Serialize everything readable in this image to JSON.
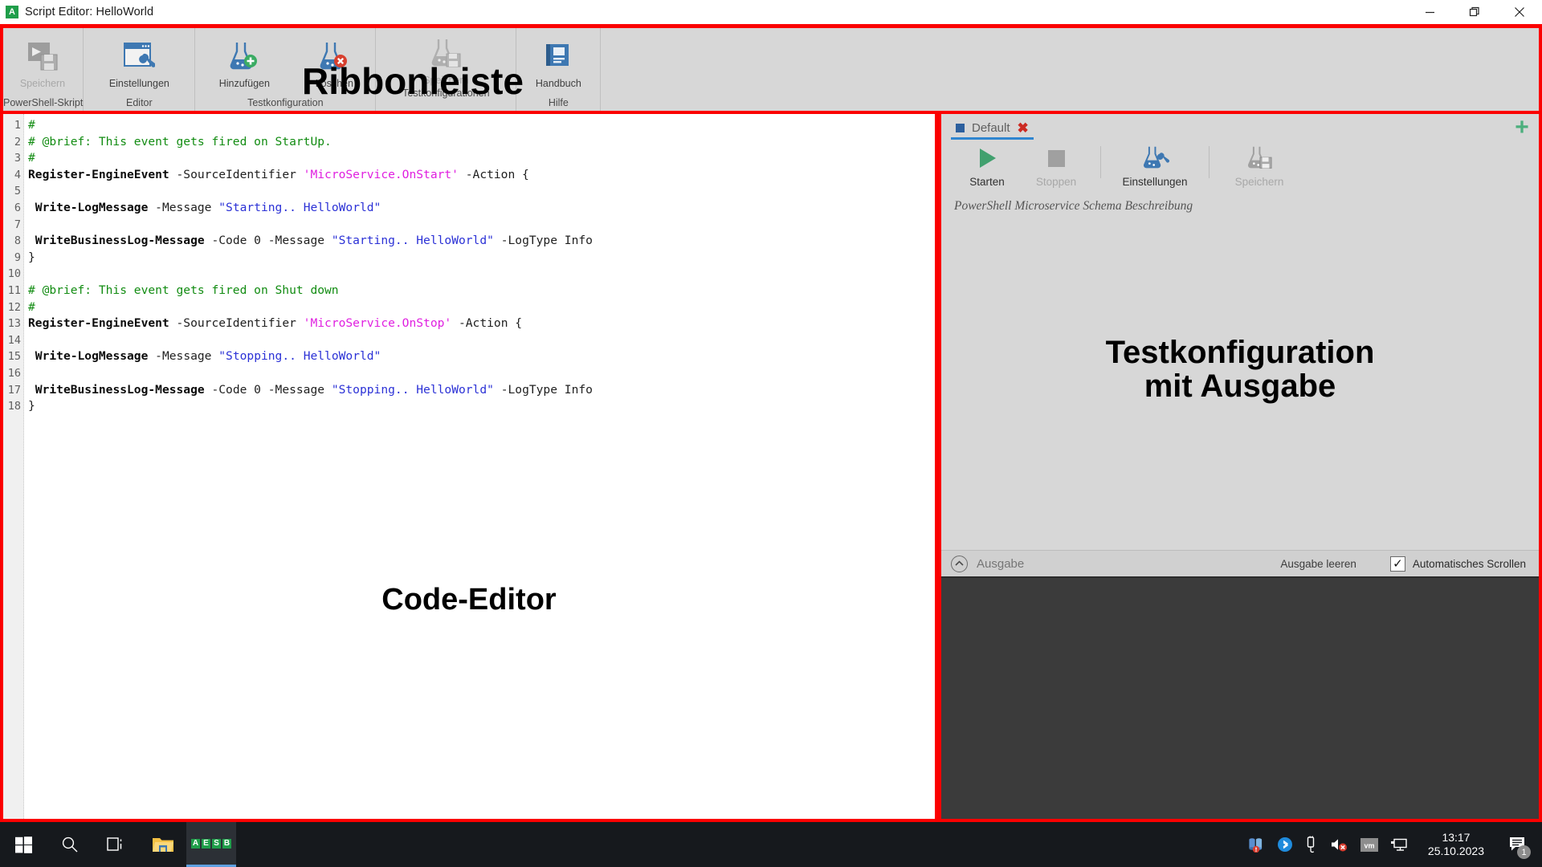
{
  "window": {
    "title": "Script Editor: HelloWorld",
    "app_icon": "A",
    "minimize": "minimize-icon",
    "maximize": "maximize-icon",
    "close": "close-icon"
  },
  "ribbon": {
    "annotation": "Ribbonleiste",
    "groups": [
      {
        "label": "PowerShell-Skript",
        "items": [
          {
            "caption": "Speichern",
            "icon": "save-script-icon",
            "disabled": true
          }
        ]
      },
      {
        "label": "Editor",
        "items": [
          {
            "caption": "Einstellungen",
            "icon": "editor-settings-icon",
            "disabled": false
          }
        ]
      },
      {
        "label": "Testkonfiguration",
        "items": [
          {
            "caption": "Hinzufügen",
            "icon": "flask-add-icon",
            "disabled": false
          },
          {
            "caption": "Löschen",
            "icon": "flask-delete-icon",
            "disabled": false
          }
        ]
      },
      {
        "label": "Testkonfigurationen",
        "items": [
          {
            "caption": "Speichern",
            "icon": "flask-save-icon",
            "disabled": true
          }
        ]
      },
      {
        "label": "Hilfe",
        "items": [
          {
            "caption": "Handbuch",
            "icon": "manual-book-icon",
            "disabled": false
          }
        ]
      }
    ]
  },
  "editor": {
    "annotation": "Code-Editor",
    "line_numbers": [
      "1",
      "2",
      "3",
      "4",
      "5",
      "6",
      "7",
      "8",
      "9",
      "10",
      "11",
      "12",
      "13",
      "14",
      "15",
      "16",
      "17",
      "18"
    ],
    "lines": [
      "#",
      "# @brief: This event gets fired on StartUp.",
      "#",
      "Register-EngineEvent -SourceIdentifier 'MicroService.OnStart' -Action {",
      "",
      " Write-LogMessage -Message \"Starting.. HelloWorld\"",
      "",
      " WriteBusinessLog-Message -Code 0 -Message \"Starting.. HelloWorld\" -LogType Info",
      "}",
      "",
      "# @brief: This event gets fired on Shut down",
      "#",
      "Register-EngineEvent -SourceIdentifier 'MicroService.OnStop' -Action {",
      "",
      " Write-LogMessage -Message \"Stopping.. HelloWorld\"",
      "",
      " WriteBusinessLog-Message -Code 0 -Message \"Stopping.. HelloWorld\" -LogType Info",
      "}"
    ]
  },
  "test_panel": {
    "annotation_line1": "Testkonfiguration",
    "annotation_line2": "mit Ausgabe",
    "add_tab_icon": "plus-icon",
    "tabs": [
      {
        "label": "Default",
        "close_icon": "close-tab-icon",
        "active": true
      }
    ],
    "toolbar": [
      {
        "caption": "Starten",
        "icon": "play-icon",
        "disabled": false
      },
      {
        "caption": "Stoppen",
        "icon": "stop-icon",
        "disabled": true
      },
      {
        "caption": "Einstellungen",
        "icon": "flask-settings-icon",
        "disabled": false
      },
      {
        "caption": "Speichern",
        "icon": "flask-save-icon",
        "disabled": true
      }
    ],
    "schema_description": "PowerShell Microservice Schema Beschreibung"
  },
  "output": {
    "collapse_icon": "chevron-up-icon",
    "title": "Ausgabe",
    "clear_label": "Ausgabe leeren",
    "autoscroll_label": "Automatisches Scrollen",
    "autoscroll_checked": true,
    "console_text": ""
  },
  "taskbar": {
    "start_icon": "windows-start-icon",
    "search_icon": "search-icon",
    "taskview_icon": "task-view-icon",
    "explorer_icon": "file-explorer-icon",
    "aesb_label": [
      "A",
      "E",
      "S",
      "B"
    ],
    "tray": [
      "database-alert-icon",
      "bluetooth-icon",
      "usb-eject-icon",
      "volume-muted-icon",
      "vmware-icon",
      "network-icon"
    ],
    "time": "13:17",
    "date": "25.10.2023",
    "notification_icon": "notification-icon",
    "notification_count": "1"
  },
  "colors": {
    "annotation_red": "#fb0000",
    "ribbon_bg": "#d7d7d7",
    "accent_blue": "#2f86d0",
    "play_green": "#41a06e",
    "plus_green": "#4caf7d"
  }
}
